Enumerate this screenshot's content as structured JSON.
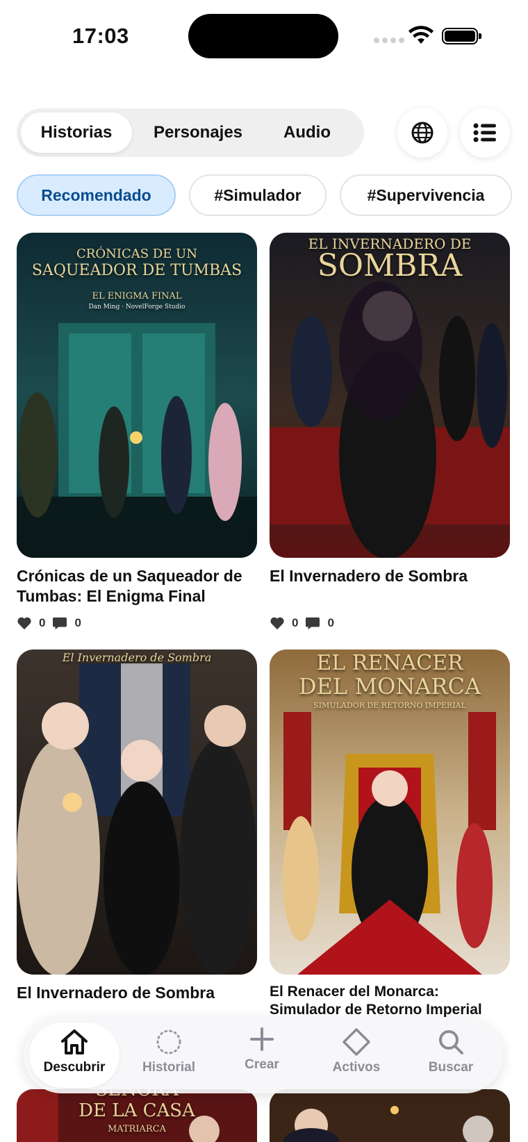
{
  "status_bar": {
    "time": "17:03"
  },
  "top_tabs": [
    {
      "label": "Historias",
      "active": true
    },
    {
      "label": "Personajes",
      "active": false
    },
    {
      "label": "Audio",
      "active": false
    }
  ],
  "top_icons": [
    "globe-icon",
    "list-icon"
  ],
  "chips": [
    {
      "label": "Recomendado",
      "active": true
    },
    {
      "label": "#Simulador",
      "active": false
    },
    {
      "label": "#Supervivencia",
      "active": false
    }
  ],
  "cards": [
    {
      "title": "Crónicas de un Saqueador de Tumbas: El Enigma Final",
      "cover_text": {
        "line1": "CRÓNICAS DE UN",
        "line2": "SAQUEADOR DE TUMBAS",
        "line3": "EL ENIGMA FINAL",
        "line4": "Dan Ming · NovelForge Studio"
      },
      "likes": "0",
      "comments": "0"
    },
    {
      "title": "El Invernadero de Sombra",
      "cover_text": {
        "line1": "EL INVERNADERO DE",
        "line2": "SOMBRA"
      },
      "likes": "0",
      "comments": "0"
    },
    {
      "title": "El Invernadero de Sombra",
      "cover_text": {
        "line1": "El Invernadero de Sombra"
      },
      "likes": "",
      "comments": ""
    },
    {
      "title": "El Renacer del Monarca: Simulador de Retorno Imperial",
      "cover_text": {
        "line1": "EL RENACER",
        "line2": "DEL MONARCA",
        "line3": "SIMULADOR DE RETORNO IMPERIAL"
      },
      "likes": "",
      "comments": ""
    },
    {
      "title": "",
      "cover_text": {
        "line1": "SEÑORA",
        "line2": "DE LA CASA",
        "line3": "MATRIARCA"
      }
    },
    {
      "title": "",
      "cover_text": {}
    }
  ],
  "bottom_nav": [
    {
      "label": "Descubrir",
      "icon": "home-icon",
      "active": true
    },
    {
      "label": "Historial",
      "icon": "history-icon",
      "active": false
    },
    {
      "label": "Crear",
      "icon": "plus-icon",
      "active": false
    },
    {
      "label": "Activos",
      "icon": "diamond-icon",
      "active": false
    },
    {
      "label": "Buscar",
      "icon": "search-icon",
      "active": false
    }
  ],
  "colors": {
    "accent_chip_bg": "#d9ecff",
    "accent_chip_text": "#0a4c8e",
    "cover_gold": "#e9d59a"
  }
}
